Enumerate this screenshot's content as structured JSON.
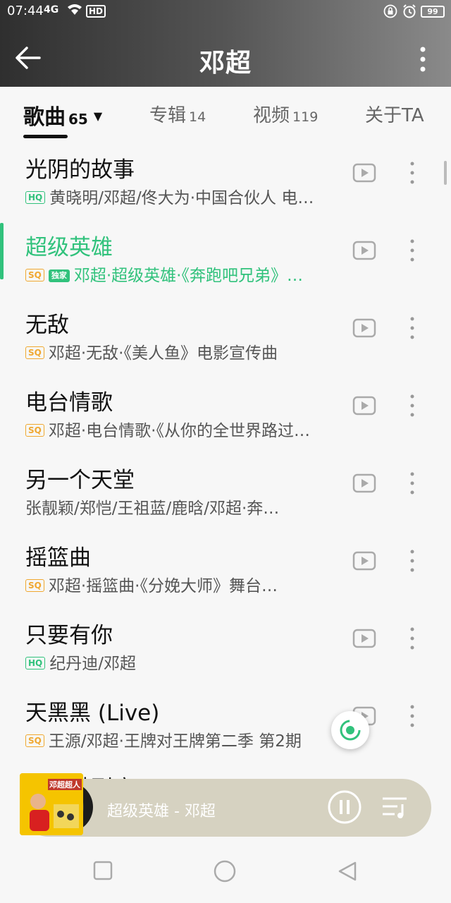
{
  "status": {
    "time": "07:44",
    "signal": "4G",
    "hd": "HD",
    "battery": "99"
  },
  "header": {
    "title": "邓超"
  },
  "tabs": [
    {
      "label": "歌曲",
      "count": "65"
    },
    {
      "label": "专辑",
      "count": "14"
    },
    {
      "label": "视频",
      "count": "119"
    },
    {
      "label": "关于TA",
      "count": ""
    }
  ],
  "songs": [
    {
      "name": "光阴的故事",
      "badge": "HQ",
      "subtitle": "黄晓明/邓超/佟大为·中国合伙人 电…"
    },
    {
      "name": "超级英雄",
      "badge": "SQ",
      "extra_badge": "独家",
      "subtitle": "邓超·超级英雄·《奔跑吧兄弟》…"
    },
    {
      "name": "无敌",
      "badge": "SQ",
      "subtitle": "邓超·无敌·《美人鱼》电影宣传曲"
    },
    {
      "name": "电台情歌",
      "badge": "SQ",
      "subtitle": "邓超·电台情歌·《从你的全世界路过…"
    },
    {
      "name": "另一个天堂",
      "badge": "",
      "subtitle": "张靓颖/郑恺/王祖蓝/鹿晗/邓超·奔…"
    },
    {
      "name": "摇篮曲",
      "badge": "SQ",
      "subtitle": "邓超·摇篮曲·《分娩大师》舞台…"
    },
    {
      "name": "只要有你",
      "badge": "HQ",
      "subtitle": "纪丹迪/邓超"
    },
    {
      "name": "天黑黑 (Live)",
      "badge": "SQ",
      "subtitle": "王源/邓超·王牌对王牌第二季 第2期"
    }
  ],
  "hidden_song": "…冷酷到底 (Live)",
  "player": {
    "now_playing": "超级英雄 - 邓超",
    "cover_text": "邓超超人"
  },
  "colors": {
    "accent": "#31c27c",
    "sq": "#f0a830",
    "player_bg": "#d6d2c1"
  }
}
